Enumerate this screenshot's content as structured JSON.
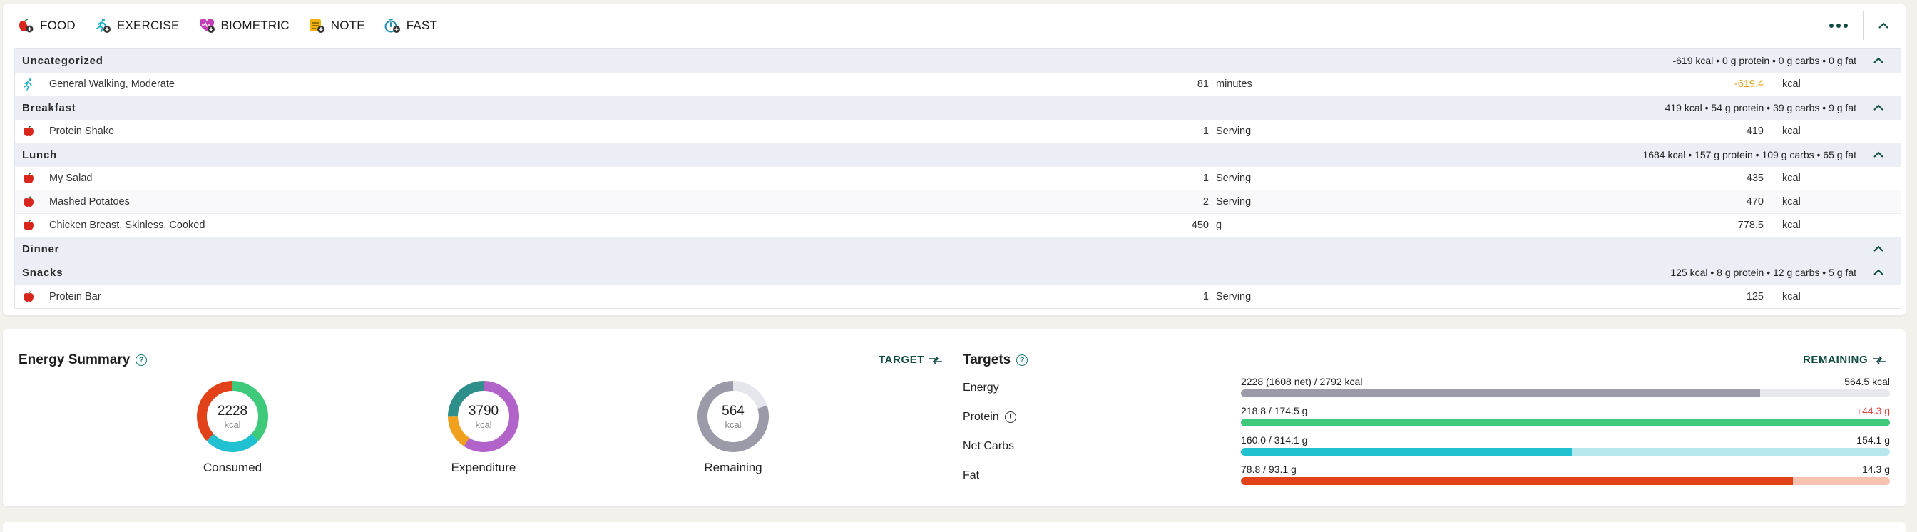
{
  "toolbar": {
    "items": [
      {
        "label": "FOOD",
        "icon": "apple-add-icon"
      },
      {
        "label": "EXERCISE",
        "icon": "runner-add-icon"
      },
      {
        "label": "BIOMETRIC",
        "icon": "heart-add-icon"
      },
      {
        "label": "NOTE",
        "icon": "note-add-icon"
      },
      {
        "label": "FAST",
        "icon": "stopwatch-add-icon"
      }
    ]
  },
  "diary": {
    "groups": [
      {
        "name": "Uncategorized",
        "summary": "-619 kcal • 0 g protein • 0 g carbs • 0 g fat",
        "items": [
          {
            "name": "General Walking, Moderate",
            "amount": "81",
            "unit": "minutes",
            "kcal": "-619.4",
            "kcal_unit": "kcal",
            "type": "exercise"
          }
        ]
      },
      {
        "name": "Breakfast",
        "summary": "419 kcal • 54 g protein • 39 g carbs • 9 g fat",
        "items": [
          {
            "name": "Protein Shake",
            "amount": "1",
            "unit": "Serving",
            "kcal": "419",
            "kcal_unit": "kcal",
            "type": "food"
          }
        ]
      },
      {
        "name": "Lunch",
        "summary": "1684 kcal • 157 g protein • 109 g carbs • 65 g fat",
        "items": [
          {
            "name": "My Salad",
            "amount": "1",
            "unit": "Serving",
            "kcal": "435",
            "kcal_unit": "kcal",
            "type": "food"
          },
          {
            "name": "Mashed Potatoes",
            "amount": "2",
            "unit": "Serving",
            "kcal": "470",
            "kcal_unit": "kcal",
            "type": "food"
          },
          {
            "name": "Chicken Breast, Skinless, Cooked",
            "amount": "450",
            "unit": "g",
            "kcal": "778.5",
            "kcal_unit": "kcal",
            "type": "food"
          }
        ]
      },
      {
        "name": "Dinner",
        "summary": "",
        "items": []
      },
      {
        "name": "Snacks",
        "summary": "125 kcal • 8 g protein • 12 g carbs • 5 g fat",
        "items": [
          {
            "name": "Protein Bar",
            "amount": "1",
            "unit": "Serving",
            "kcal": "125",
            "kcal_unit": "kcal",
            "type": "food"
          }
        ]
      }
    ]
  },
  "energy_summary": {
    "title": "Energy Summary",
    "target_label": "TARGET",
    "consumed": {
      "value": "2228",
      "unit": "kcal",
      "label": "Consumed"
    },
    "expenditure": {
      "value": "3790",
      "unit": "kcal",
      "label": "Expenditure"
    },
    "remaining": {
      "value": "564",
      "unit": "kcal",
      "label": "Remaining"
    }
  },
  "targets": {
    "title": "Targets",
    "remaining_label": "REMAINING",
    "rows": [
      {
        "label": "Energy",
        "value": "2228 (1608 net) / 2792 kcal",
        "remaining": "564.5 kcal",
        "fraction": 0.8,
        "color": "#9b9aa8",
        "track": "#e7e7ee",
        "over": false,
        "help": false
      },
      {
        "label": "Protein",
        "value": "218.8 / 174.5 g",
        "remaining": "+44.3 g",
        "fraction": 1.0,
        "color": "#3fc97a",
        "track": "#c6eed6",
        "over": true,
        "help": true
      },
      {
        "label": "Net Carbs",
        "value": "160.0 / 314.1 g",
        "remaining": "154.1 g",
        "fraction": 0.51,
        "color": "#22c1d1",
        "track": "#b7e8ee",
        "over": false,
        "help": false
      },
      {
        "label": "Fat",
        "value": "78.8 / 93.1 g",
        "remaining": "14.3 g",
        "fraction": 0.85,
        "color": "#e2421a",
        "track": "#f7c2b0",
        "over": false,
        "help": false
      }
    ]
  }
}
